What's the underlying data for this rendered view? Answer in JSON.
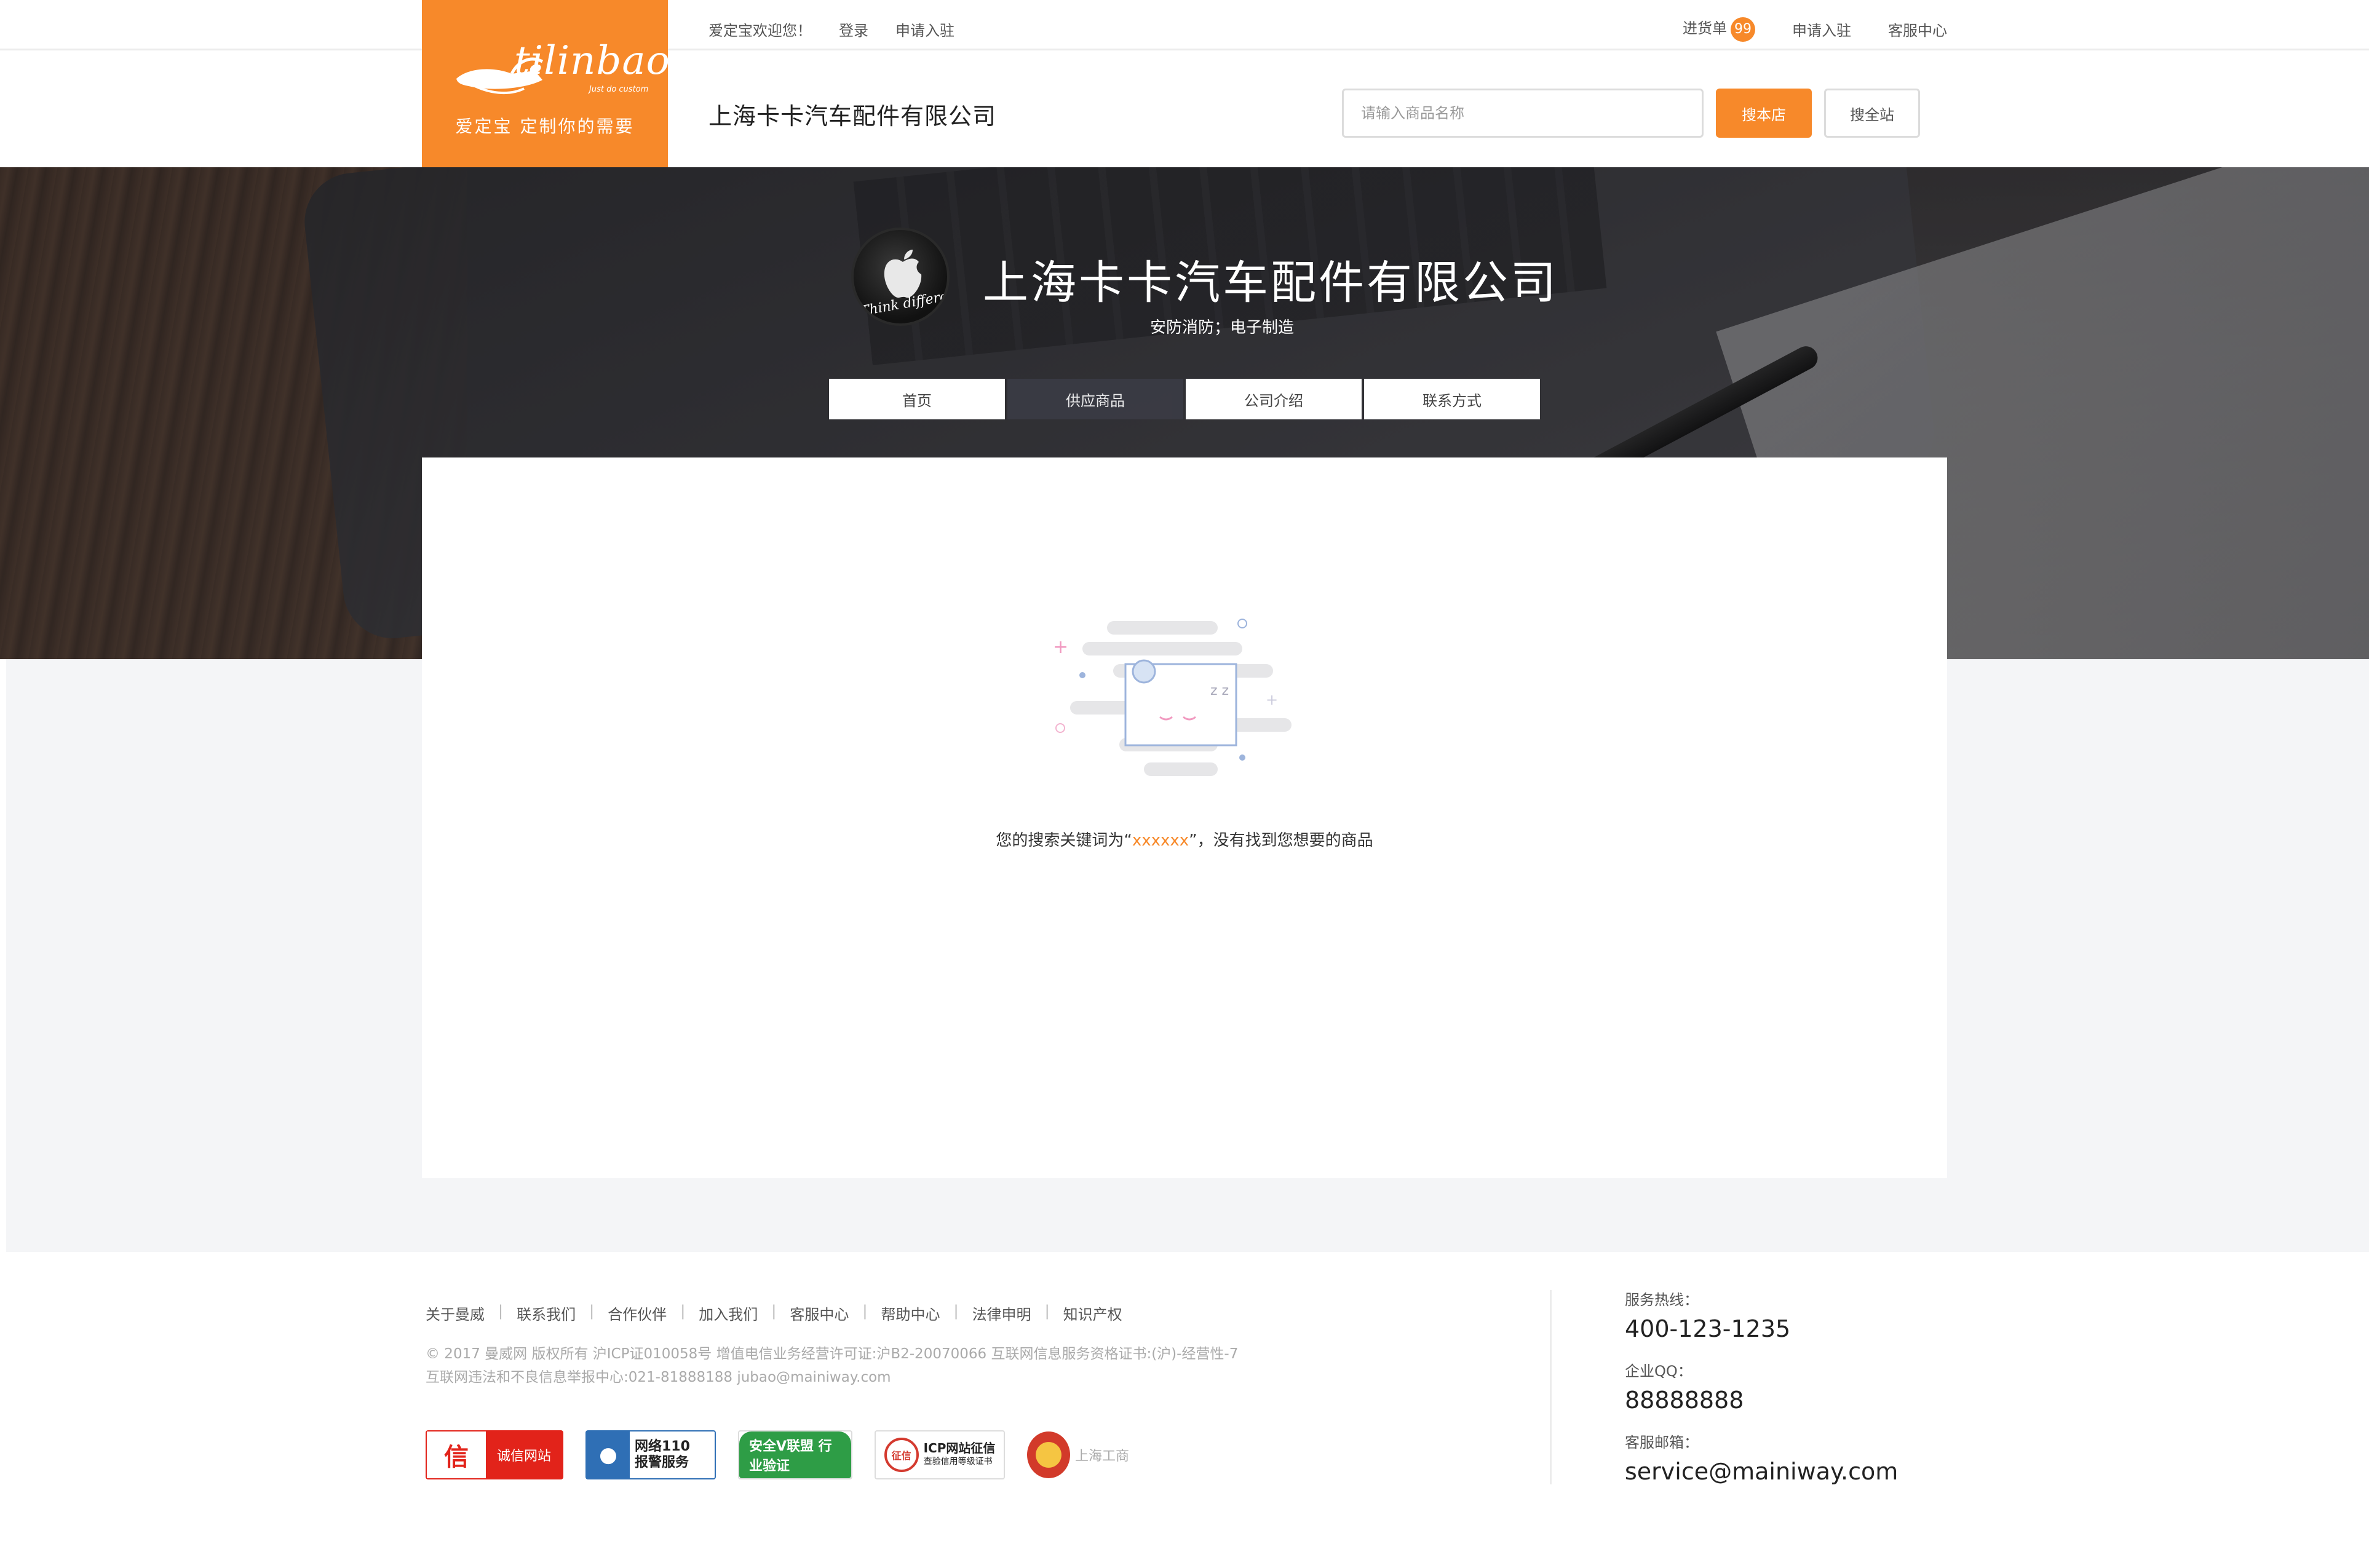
{
  "topbar": {
    "welcome": "爱定宝欢迎您！",
    "login": "登录",
    "apply": "申请入驻",
    "cart": "进货单",
    "cart_count": "99",
    "apply_right": "申请入驻",
    "service": "客服中心"
  },
  "logo": {
    "brand": "tilinbao",
    "tagline_small": "Just do custom",
    "slogan": "爱定宝  定制你的需要"
  },
  "store": {
    "name": "上海卡卡汽车配件有限公司",
    "search_placeholder": "请输入商品名称",
    "search_store": "搜本店",
    "search_all": "搜全站"
  },
  "hero": {
    "title": "上海卡卡汽车配件有限公司",
    "subtitle": "安防消防；电子制造",
    "avatar_text": "Think different"
  },
  "nav": {
    "tabs": [
      {
        "label": "首页",
        "active": false
      },
      {
        "label": "供应商品",
        "active": true
      },
      {
        "label": "公司介绍",
        "active": false
      },
      {
        "label": "联系方式",
        "active": false
      }
    ]
  },
  "empty": {
    "prefix": "您的搜索关键词为“",
    "keyword": "xxxxxx",
    "suffix": "”，没有找到您想要的商品"
  },
  "footer": {
    "links": [
      "关于曼威",
      "联系我们",
      "合作伙伴",
      "加入我们",
      "客服中心",
      "帮助中心",
      "法律申明",
      "知识产权"
    ],
    "copyright": "© 2017 曼威网 版权所有  沪ICP证010058号   增值电信业务经营许可证:沪B2-20070066      互联网信息服务资格证书:(沪)-经营性-7",
    "report": "互联网违法和不良信息举报中心:021-81888188 jubao@mainiway.com",
    "badges": {
      "b1_left": "信",
      "b1_right": "诚信网站",
      "b2_line1": "网络110",
      "b2_line2": "报警服务",
      "b3": "安全V联盟 行业验证",
      "b4_seal": "征信",
      "b4_line1": "ICP网站征信",
      "b4_line2": "查验信用等级证书",
      "b5": "上海工商"
    },
    "hotline_label": "服务热线：",
    "hotline": "400-123-1235",
    "qq_label": "企业QQ：",
    "qq": "88888888",
    "email_label": "客服邮箱：",
    "email": "service@mainiway.com"
  },
  "colors": {
    "accent": "#f7892a",
    "nav_active": "#3b3c45",
    "band": "#f4f5f7"
  }
}
